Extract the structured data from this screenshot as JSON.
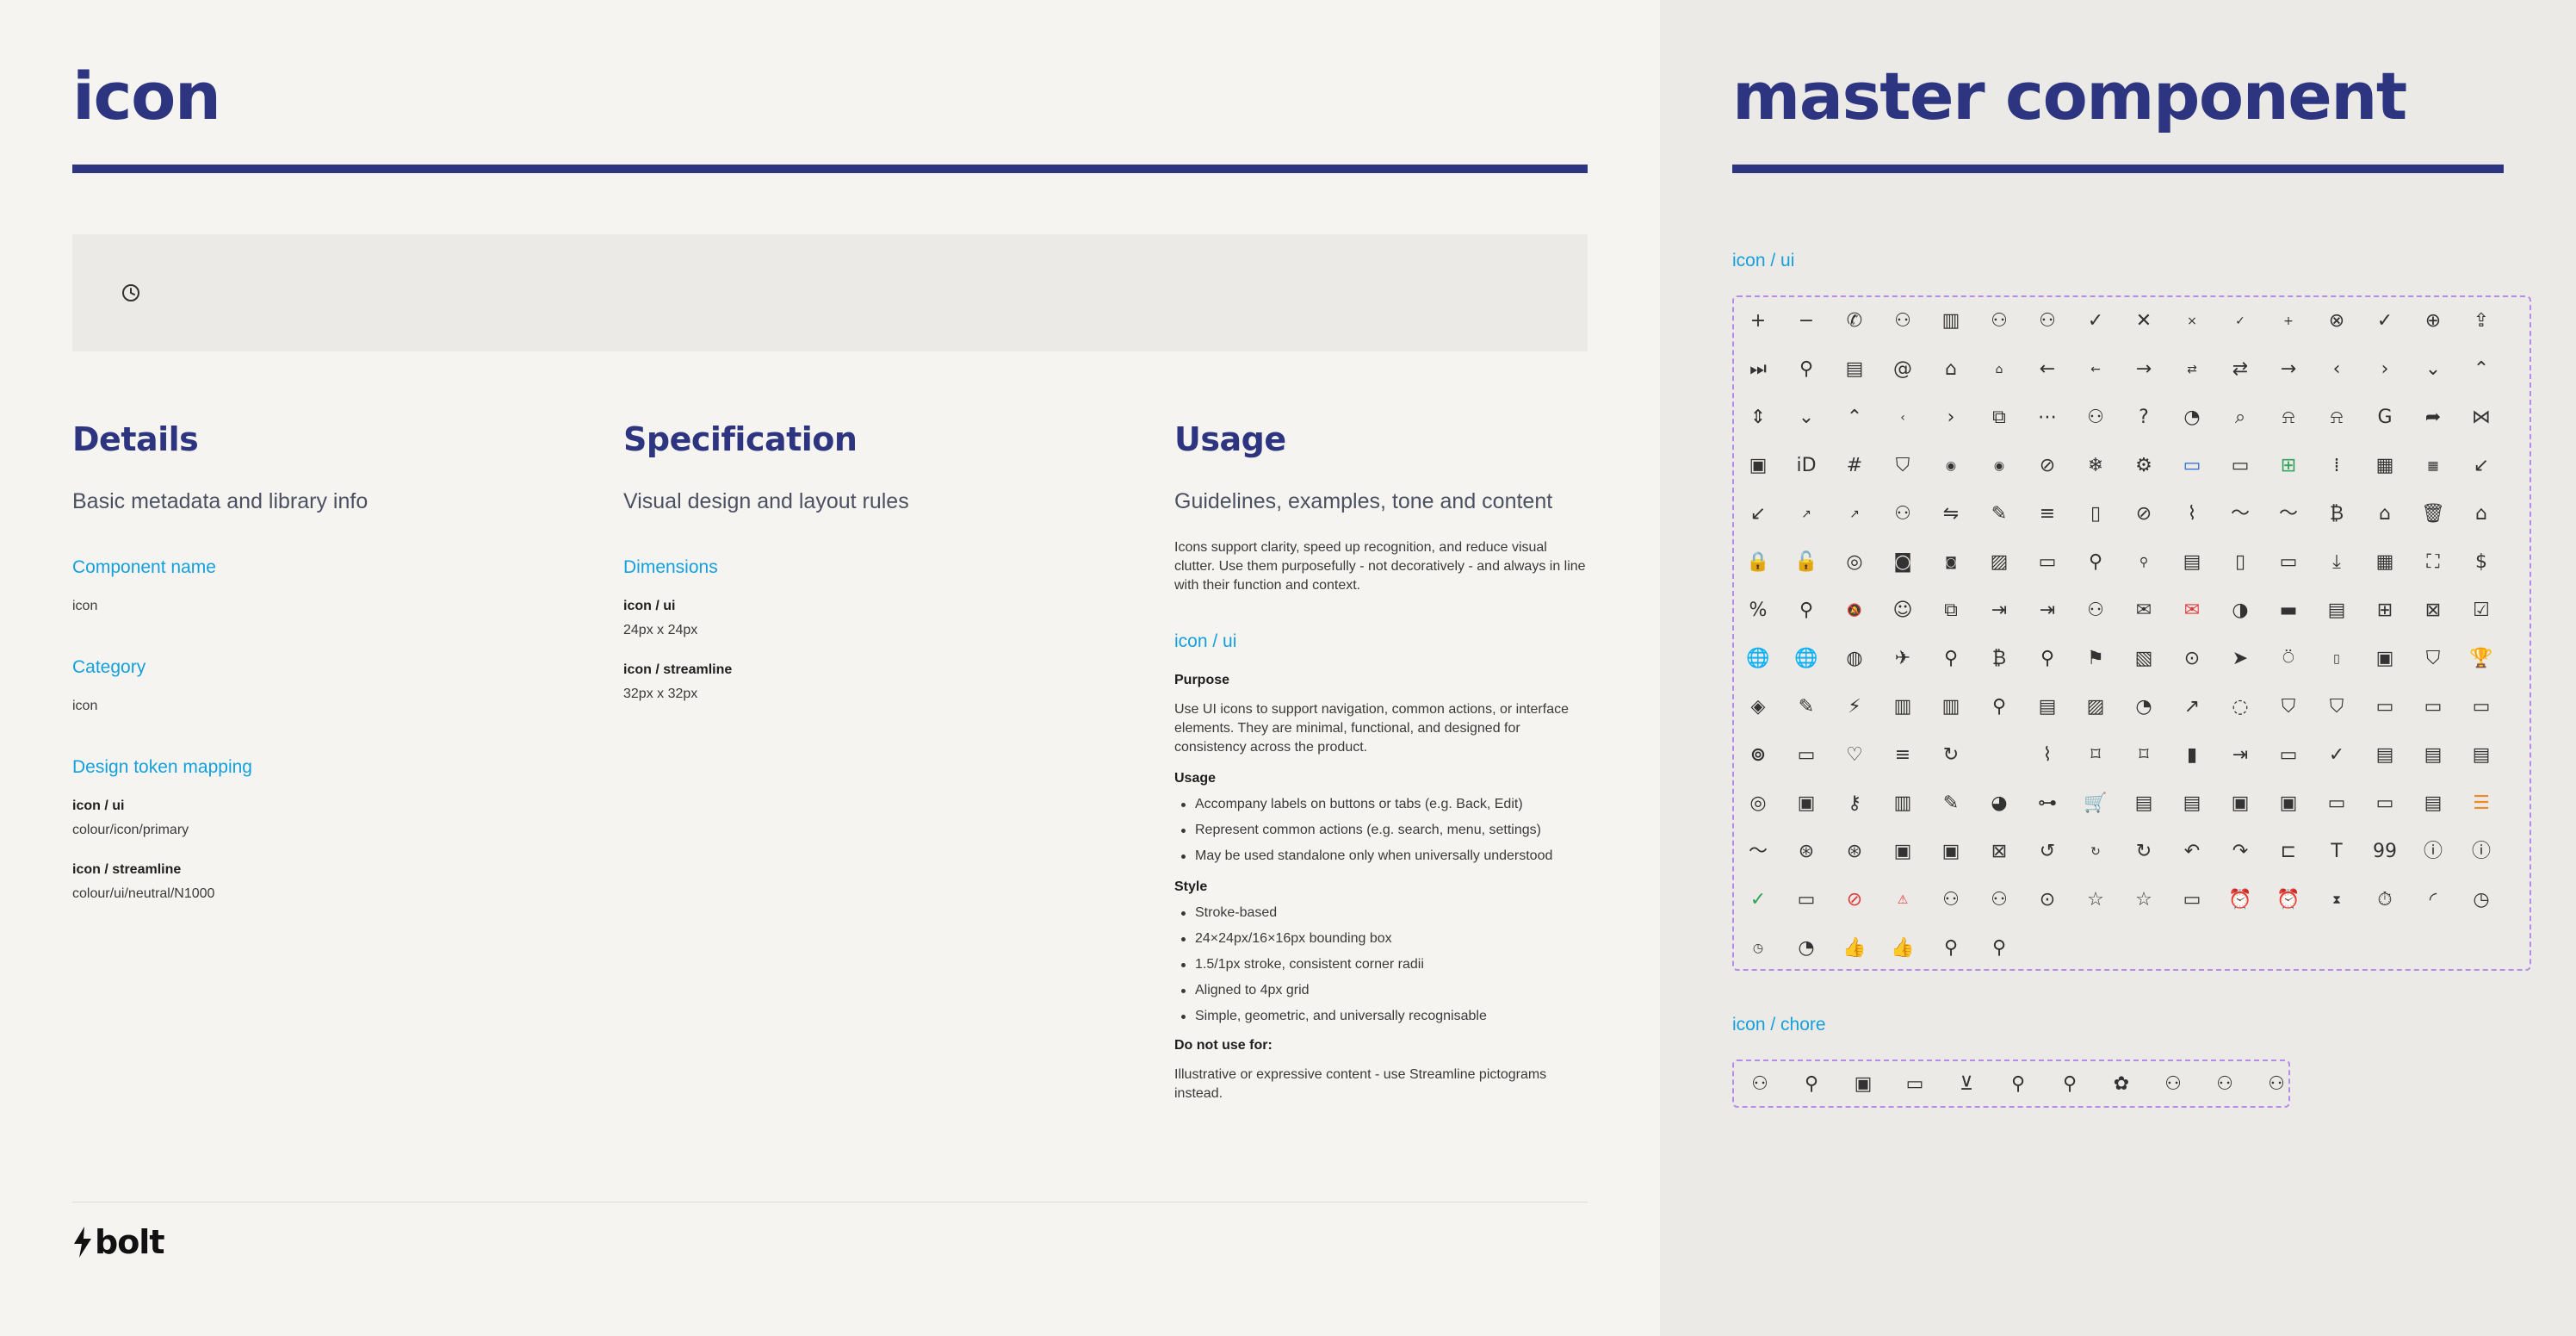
{
  "left": {
    "title": "icon",
    "details": {
      "title": "Details",
      "subtitle": "Basic metadata and library info",
      "component_name_label": "Component name",
      "component_name_value": "icon",
      "category_label": "Category",
      "category_value": "icon",
      "token_label": "Design token mapping",
      "token_ui_label": "icon / ui",
      "token_ui_value": "colour/icon/primary",
      "token_stream_label": "icon / streamline",
      "token_stream_value": "colour/ui/neutral/N1000"
    },
    "spec": {
      "title": "Specification",
      "subtitle": "Visual design and layout rules",
      "dimensions_label": "Dimensions",
      "ui_label": "icon / ui",
      "ui_value": "24px x 24px",
      "stream_label": "icon / streamline",
      "stream_value": "32px x 32px"
    },
    "usage": {
      "title": "Usage",
      "subtitle": "Guidelines, examples, tone and content",
      "intro": "Icons support clarity, speed up recognition, and reduce visual clutter. Use them purposefully - not decoratively - and always in line with their function and context.",
      "ui_heading": "icon / ui",
      "purpose_label": "Purpose",
      "purpose_text": "Use UI icons to support navigation, common actions, or interface elements. They are minimal, functional, and designed for consistency across the product.",
      "usage_label": "Usage",
      "usage_items": [
        "Accompany labels on buttons or tabs (e.g. Back, Edit)",
        "Represent common actions (e.g. search, menu, settings)",
        "May be used standalone only when universally understood"
      ],
      "style_label": "Style",
      "style_items": [
        "Stroke-based",
        "24×24px/16×16px bounding box",
        "1.5/1px stroke, consistent corner radii",
        "Aligned to 4px grid",
        "Simple, geometric, and universally recognisable"
      ],
      "donot_label": "Do not use for:",
      "donot_text": "Illustrative or expressive content - use Streamline pictograms instead."
    },
    "logo": "bolt"
  },
  "right": {
    "title": "master component",
    "ui_section_label": "icon / ui",
    "chore_section_label": "icon / chore",
    "ui_icons": [
      "+",
      "−",
      "✆",
      "⚇",
      "▥",
      "⚇",
      "⚇",
      "✓",
      "✕",
      "×",
      "✓",
      "+",
      "⊗",
      "✓",
      "⊕",
      "⇪",
      "⏭",
      "⚲",
      "▤",
      "@",
      "⌂",
      "⌂",
      "←",
      "←",
      "→",
      "⇄",
      "⇄",
      "→",
      "‹",
      "›",
      "⌄",
      "⌃",
      "⇕",
      "⌄",
      "⌃",
      "‹",
      "›",
      "⧉",
      "⋯",
      "⚇",
      "?",
      "◔",
      "⌕",
      "⍾",
      "⍾",
      "G",
      "➦",
      "⋈",
      "▣",
      "iD",
      "#",
      "⛉",
      "◉",
      "◉",
      "⊘",
      "❄",
      "⚙",
      "▭",
      "▭",
      "⊞",
      "⁞",
      "▦",
      "▦",
      "↙",
      "↙",
      "↗",
      "↗",
      "⚇",
      "⇋",
      "✎",
      "≡",
      "▯",
      "⊘",
      "⌇",
      "〜",
      "〜",
      "₿",
      "⌂",
      "🗑",
      "⌂",
      "🔒",
      "🔓",
      "◎",
      "◙",
      "◙",
      "▨",
      "▭",
      "⚲",
      "⚲",
      "▤",
      "▯",
      "▭",
      "⤓",
      "▦",
      "⛶",
      "$",
      "%",
      "⚲",
      "🔕",
      "☺",
      "⧉",
      "⇥",
      "⇥",
      "⚇",
      "✉",
      "✉",
      "◑",
      "▬",
      "▤",
      "⊞",
      "⊠",
      "☑",
      "🌐",
      "🌐",
      "◍",
      "✈",
      "⚲",
      "₿",
      "⚲",
      "⚑",
      "▧",
      "⊙",
      "➤",
      "⍥",
      "▯",
      "▣",
      "⛉",
      "🏆",
      "◈",
      "✎",
      "⚡",
      "▥",
      "▥",
      "⚲",
      "▤",
      "▨",
      "◔",
      "↗",
      "◌",
      "⛉",
      "⛉",
      "▭",
      "▭",
      "▭",
      "⊚",
      "▭",
      "♡",
      "≡",
      "↻",
      "",
      "⌇",
      "⌑",
      "⌑",
      "▮",
      "⇥",
      "▭",
      "✓",
      "▤",
      "▤",
      "▤",
      "◎",
      "▣",
      "⚷",
      "▥",
      "✎",
      "◕",
      "⊶",
      "🛒",
      "▤",
      "▤",
      "▣",
      "▣",
      "▭",
      "▭",
      "▤",
      "☰",
      "〜",
      "⊛",
      "⊛",
      "▣",
      "▣",
      "⊠",
      "↺",
      "↻",
      "↻",
      "↶",
      "↷",
      "⊏",
      "T",
      "99",
      "ⓘ",
      "ⓘ",
      "✓",
      "▭",
      "⊘",
      "⚠",
      "⚇",
      "⚇",
      "⊙",
      "☆",
      "☆",
      "▭",
      "⏰",
      "⏰",
      "⧗",
      "⏱",
      "◜",
      "◷",
      "◷",
      "◔",
      "👍",
      "👍",
      "⚲",
      "⚲"
    ],
    "chore_icons": [
      "⚇",
      "⚲",
      "▣",
      "▭",
      "⊻",
      "⚲",
      "⚲",
      "✿",
      "⚇",
      "⚇",
      "⚇"
    ]
  }
}
